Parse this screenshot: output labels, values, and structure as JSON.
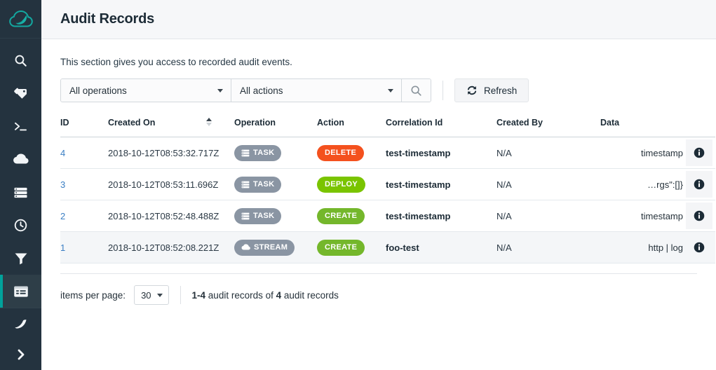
{
  "brand": {
    "logo_name": "spring-cloud-data-flow-logo"
  },
  "sidebar": {
    "items": [
      {
        "icon": "search-icon",
        "name": "sidebar-item-search",
        "active": false
      },
      {
        "icon": "tags-icon",
        "name": "sidebar-item-apps",
        "active": false
      },
      {
        "icon": "terminal-icon",
        "name": "sidebar-item-shell",
        "active": false
      },
      {
        "icon": "cloud-icon",
        "name": "sidebar-item-streams",
        "active": false
      },
      {
        "icon": "server-icon",
        "name": "sidebar-item-tasks",
        "active": false
      },
      {
        "icon": "clock-icon",
        "name": "sidebar-item-jobs",
        "active": false
      },
      {
        "icon": "filter-icon",
        "name": "sidebar-item-analytics",
        "active": false
      },
      {
        "icon": "records-icon",
        "name": "sidebar-item-audit-records",
        "active": true
      }
    ],
    "bottom": [
      {
        "icon": "leaf-icon",
        "name": "sidebar-item-about"
      },
      {
        "icon": "chevron-right-icon",
        "name": "sidebar-expand-toggle"
      }
    ]
  },
  "header": {
    "title": "Audit Records"
  },
  "main": {
    "description": "This section gives you access to recorded audit events.",
    "toolbar": {
      "operations_value": "All operations",
      "actions_value": "All actions",
      "search_icon": "search-icon",
      "refresh_label": "Refresh",
      "refresh_icon": "refresh-icon"
    },
    "table": {
      "columns": [
        "ID",
        "Created On",
        "Operation",
        "Action",
        "Correlation Id",
        "Created By",
        "Data",
        ""
      ],
      "sorted_column": "Created On",
      "sort_direction": "asc",
      "rows": [
        {
          "id": "4",
          "created_on": "2018-10-12T08:53:32.717Z",
          "operation": "TASK",
          "operation_icon": "server-icon",
          "action": "DELETE",
          "action_color": "#f4511e",
          "correlation_id": "test-timestamp",
          "created_by": "N/A",
          "data": "timestamp",
          "info_icon": "info-icon",
          "highlighted": false
        },
        {
          "id": "3",
          "created_on": "2018-10-12T08:53:11.696Z",
          "operation": "TASK",
          "operation_icon": "server-icon",
          "action": "DEPLOY",
          "action_color": "#7ac400",
          "correlation_id": "test-timestamp",
          "created_by": "N/A",
          "data": "…rgs\":[]}",
          "info_icon": "info-icon",
          "highlighted": false
        },
        {
          "id": "2",
          "created_on": "2018-10-12T08:52:48.488Z",
          "operation": "TASK",
          "operation_icon": "server-icon",
          "action": "CREATE",
          "action_color": "#74b72b",
          "correlation_id": "test-timestamp",
          "created_by": "N/A",
          "data": "timestamp",
          "info_icon": "info-icon",
          "highlighted": false
        },
        {
          "id": "1",
          "created_on": "2018-10-12T08:52:08.221Z",
          "operation": "STREAM",
          "operation_icon": "cloud-icon",
          "action": "CREATE",
          "action_color": "#74b72b",
          "correlation_id": "foo-test",
          "created_by": "N/A",
          "data": "http | log",
          "info_icon": "info-icon",
          "highlighted": true
        }
      ]
    },
    "pager": {
      "items_per_page_label": "items per page:",
      "items_per_page_value": "30",
      "range": "1-4",
      "range_suffix": " audit records of ",
      "total": "4",
      "total_suffix": " audit records"
    }
  },
  "colors": {
    "sidebar_bg": "#24333f",
    "accent_teal": "#00a29b",
    "badge_gray": "#8a95a3",
    "link_blue": "#3b7fc4"
  }
}
